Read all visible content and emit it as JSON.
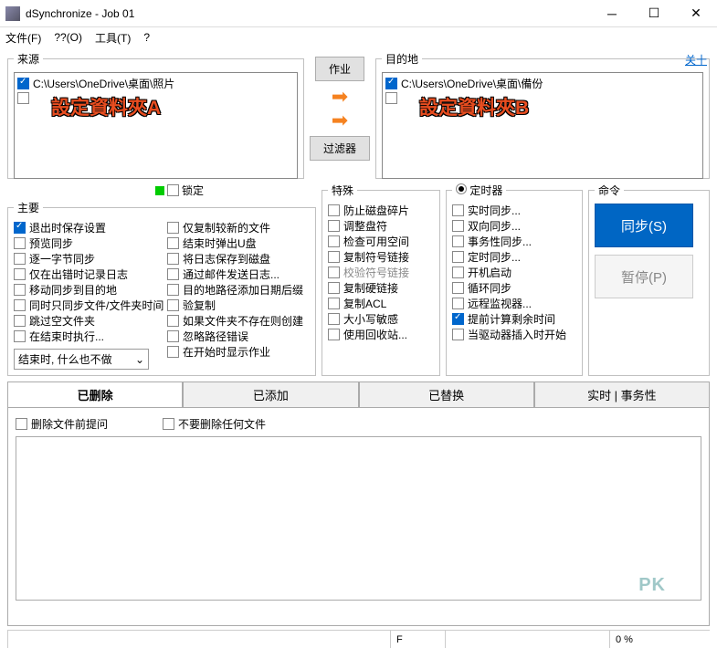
{
  "window": {
    "title": "dSynchronize - Job 01"
  },
  "menu": {
    "file": "文件(F)",
    "q": "??(O)",
    "tools": "工具(T)",
    "help": "?"
  },
  "source": {
    "legend": "来源",
    "path": "C:\\Users\\OneDrive\\桌面\\照片",
    "annot": "設定資料夾A"
  },
  "mid": {
    "job": "作业",
    "filter": "过滤器"
  },
  "dest": {
    "legend": "目的地",
    "close": "关十",
    "path": "C:\\Users\\OneDrive\\桌面\\備份",
    "annot": "設定資料夾B"
  },
  "lock": "锁定",
  "main": {
    "legend": "主要",
    "left": [
      "退出时保存设置",
      "预览同步",
      "逐一字节同步",
      "仅在出错时记录日志",
      "移动同步到目的地",
      "同时只同步文件/文件夹时间",
      "跳过空文件夹",
      "在结束时执行..."
    ],
    "right": [
      "仅复制较新的文件",
      "结束时弹出U盘",
      "将日志保存到磁盘",
      "通过邮件发送日志...",
      "目的地路径添加日期后缀",
      "验复制",
      "如果文件夹不存在则创建",
      "忽略路径错误",
      "在开始时显示作业"
    ],
    "select": "结束时, 什么也不做"
  },
  "special": {
    "legend": "特殊",
    "items": [
      "防止磁盘碎片",
      "调整盘符",
      "检查可用空间",
      "复制符号链接",
      "校验符号链接",
      "复制硬链接",
      "复制ACL",
      "大小写敏感",
      "使用回收站..."
    ]
  },
  "timer": {
    "legend": "定时器",
    "items": [
      "实时同步...",
      "双向同步...",
      "事务性同步...",
      "定时同步...",
      "开机启动",
      "循环同步",
      "远程监视器...",
      "提前计算剩余时间",
      "当驱动器插入时开始"
    ]
  },
  "cmd": {
    "legend": "命令",
    "sync": "同步(S)",
    "pause": "暂停(P)"
  },
  "tabs": {
    "deleted": "已删除",
    "added": "已添加",
    "replaced": "已替换",
    "rt": "实时 | 事务性"
  },
  "tabopts": {
    "prompt": "删除文件前提问",
    "nodel": "不要删除任何文件"
  },
  "watermark": "PK",
  "status": {
    "f": "F",
    "pct": "0 %"
  }
}
